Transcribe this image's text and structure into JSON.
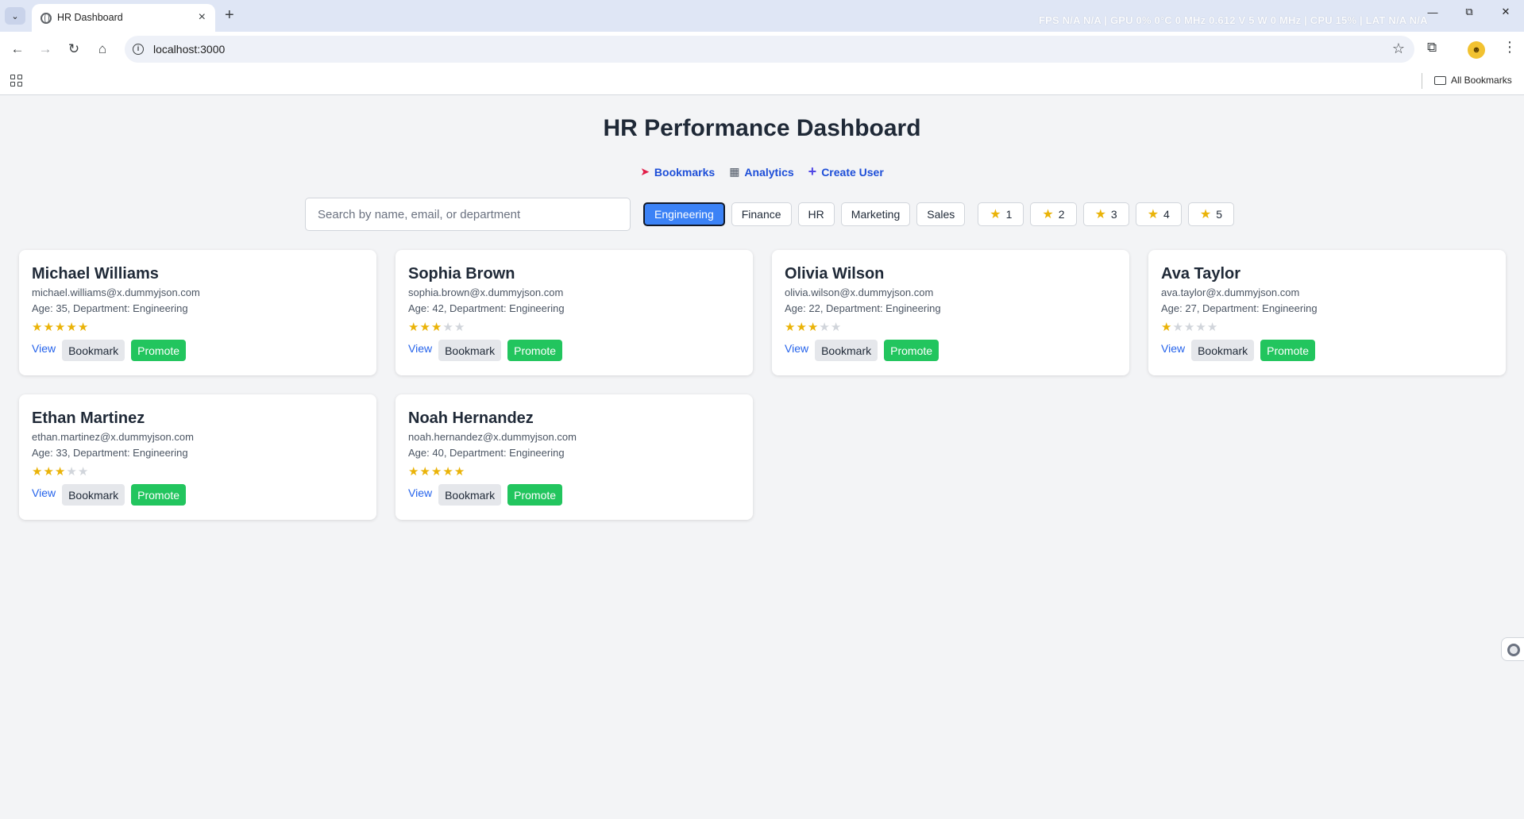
{
  "browser": {
    "tab_title": "HR Dashboard",
    "url": "localhost:3000",
    "all_bookmarks_label": "All Bookmarks",
    "perf_overlay": "FPS  N/A  N/A  |  GPU  0%  0°C  0 MHz  0.612 V  5 W  0 MHz  |  CPU  15%  |  LAT  N/A  N/A"
  },
  "header": {
    "title": "HR Performance Dashboard",
    "links": [
      {
        "label": "Bookmarks",
        "icon": "pushpin-icon"
      },
      {
        "label": "Analytics",
        "icon": "bar-chart-icon"
      },
      {
        "label": "Create User",
        "icon": "plus-icon"
      }
    ]
  },
  "filters": {
    "search_placeholder": "Search by name, email, or department",
    "departments": [
      "Engineering",
      "Finance",
      "HR",
      "Marketing",
      "Sales"
    ],
    "active_department": "Engineering",
    "ratings": [
      "1",
      "2",
      "3",
      "4",
      "5"
    ]
  },
  "card_labels": {
    "view": "View",
    "bookmark": "Bookmark",
    "promote": "Promote"
  },
  "employees": [
    {
      "name": "Michael Williams",
      "email": "michael.williams@x.dummyjson.com",
      "meta": "Age: 35, Department: Engineering",
      "rating": 5
    },
    {
      "name": "Sophia Brown",
      "email": "sophia.brown@x.dummyjson.com",
      "meta": "Age: 42, Department: Engineering",
      "rating": 3
    },
    {
      "name": "Olivia Wilson",
      "email": "olivia.wilson@x.dummyjson.com",
      "meta": "Age: 22, Department: Engineering",
      "rating": 3
    },
    {
      "name": "Ava Taylor",
      "email": "ava.taylor@x.dummyjson.com",
      "meta": "Age: 27, Department: Engineering",
      "rating": 1
    },
    {
      "name": "Ethan Martinez",
      "email": "ethan.martinez@x.dummyjson.com",
      "meta": "Age: 33, Department: Engineering",
      "rating": 3
    },
    {
      "name": "Noah Hernandez",
      "email": "noah.hernandez@x.dummyjson.com",
      "meta": "Age: 40, Department: Engineering",
      "rating": 5
    }
  ],
  "colors": {
    "active_filter": "#3b82f6",
    "promote": "#22c55e",
    "star_on": "#eab308",
    "star_off": "#d1d5db",
    "link": "#2563eb"
  }
}
